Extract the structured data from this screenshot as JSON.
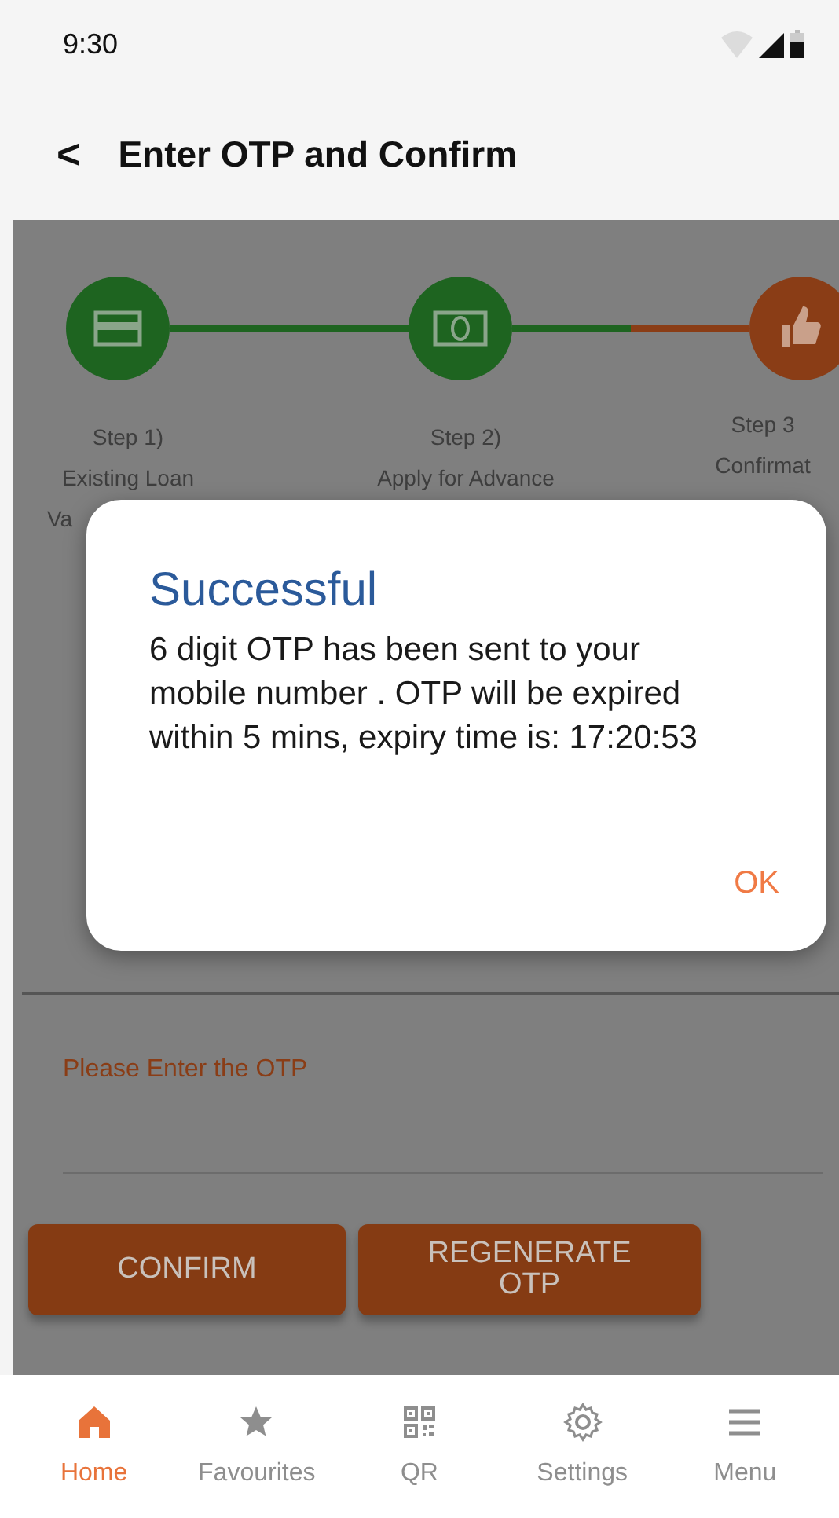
{
  "status_bar": {
    "time": "9:30"
  },
  "header": {
    "back": "<",
    "title": "Enter OTP and Confirm"
  },
  "steps": [
    {
      "lines": [
        "Step 1)",
        "Existing Loan",
        "Va"
      ],
      "done": true
    },
    {
      "lines": [
        "Step 2)",
        "Apply for Advance"
      ],
      "done": true
    },
    {
      "lines": [
        "Step 3",
        "Confirmat"
      ],
      "done": false
    }
  ],
  "otp_field": {
    "placeholder": "Please Enter the OTP"
  },
  "buttons": [
    "CONFIRM",
    "REGENERATE OTP"
  ],
  "dialog": {
    "title": "Successful",
    "message": "6 digit OTP has been sent to your mobile number . OTP will be expired within 5 mins, expiry time is: 17:20:53",
    "button": "OK"
  },
  "bottom_nav": [
    {
      "label": "Home",
      "selected": true
    },
    {
      "label": "Favourites",
      "selected": false
    },
    {
      "label": "QR",
      "selected": false
    },
    {
      "label": "Settings",
      "selected": false
    },
    {
      "label": "Menu",
      "selected": false
    }
  ]
}
